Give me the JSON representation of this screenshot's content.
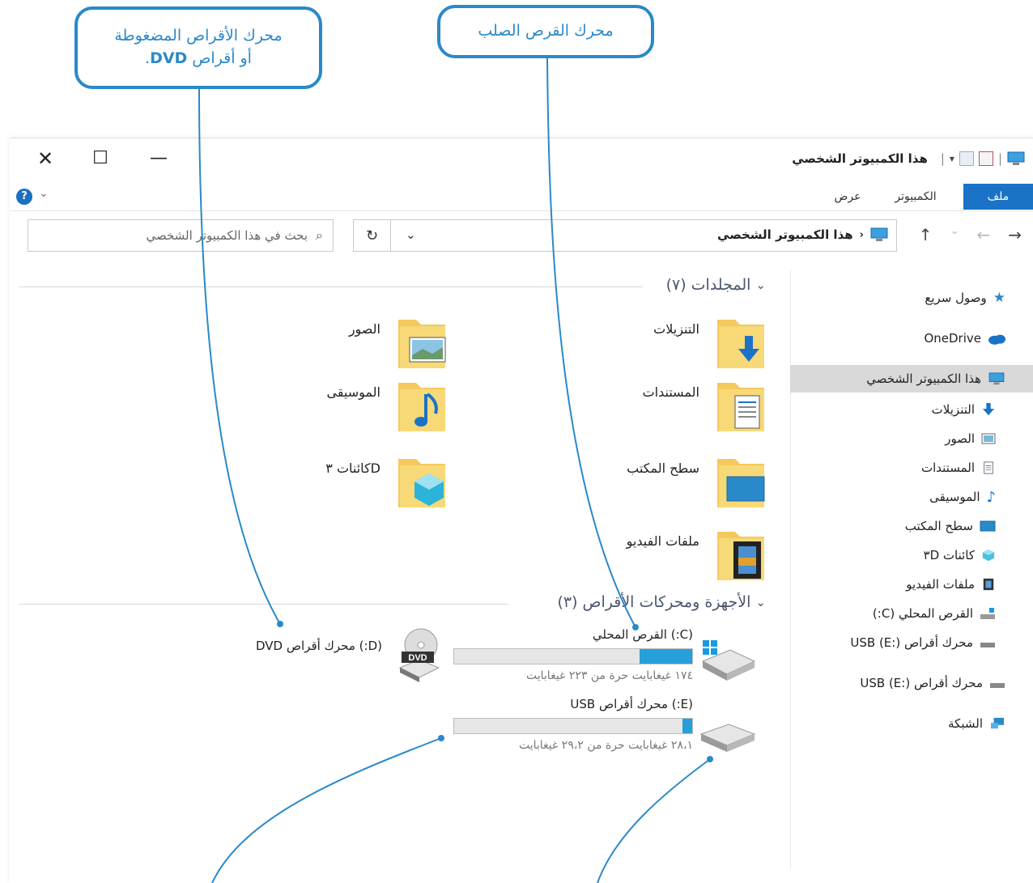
{
  "callouts": {
    "hdd": "محرك القرص الصلب",
    "dvd_line1": "محرك الأقراص المضغوطة",
    "dvd_line2_prefix": "أو أقراص",
    "dvd_line2_bold": "DVD",
    "dvd_line2_suffix": "."
  },
  "window": {
    "title": "هذا الكمبيوتر الشخصي",
    "controls": {
      "close": "✕",
      "maximize": "☐",
      "minimize": "—"
    }
  },
  "ribbon": {
    "tabs": [
      {
        "label": "ملف",
        "active": true
      },
      {
        "label": "الكمبيوتر",
        "active": false
      },
      {
        "label": "عرض",
        "active": false
      }
    ],
    "help": "?"
  },
  "address": {
    "path": "هذا الكمبيوتر الشخصي",
    "search_placeholder": "بحث في هذا الكمبيوتر الشخصي"
  },
  "sidebar": {
    "items": [
      {
        "label": "وصول سريع",
        "icon": "star-icon"
      },
      {
        "label": "OneDrive",
        "icon": "cloud-icon"
      },
      {
        "label": "هذا الكمبيوتر الشخصي",
        "icon": "computer-icon",
        "selected": true
      },
      {
        "label": "التنزيلات",
        "icon": "download-icon"
      },
      {
        "label": "الصور",
        "icon": "pictures-icon"
      },
      {
        "label": "المستندات",
        "icon": "documents-icon"
      },
      {
        "label": "الموسيقى",
        "icon": "music-icon"
      },
      {
        "label": "سطح المكتب",
        "icon": "desktop-icon"
      },
      {
        "label": "كائنات ٣D",
        "icon": "3d-objects-icon"
      },
      {
        "label": "ملفات الفيديو",
        "icon": "video-icon"
      },
      {
        "label": "القرص المحلي (C:)",
        "icon": "local-disk-icon"
      },
      {
        "label": "محرك أقراص USB (E:)",
        "icon": "usb-drive-icon"
      },
      {
        "label": "محرك أقراص USB (E:)",
        "icon": "usb-drive-icon"
      },
      {
        "label": "الشبكة",
        "icon": "network-icon"
      }
    ]
  },
  "folders_section": {
    "title": "المجلدات (٧)",
    "items": [
      {
        "label": "التنزيلات",
        "icon": "downloads-folder-icon"
      },
      {
        "label": "الصور",
        "icon": "pictures-folder-icon"
      },
      {
        "label": "المستندات",
        "icon": "documents-folder-icon"
      },
      {
        "label": "الموسيقى",
        "icon": "music-folder-icon"
      },
      {
        "label": "سطح المكتب",
        "icon": "desktop-folder-icon"
      },
      {
        "label": "Dكائنات ٣",
        "icon": "3d-objects-folder-icon"
      },
      {
        "label": "ملفات الفيديو",
        "icon": "videos-folder-icon"
      }
    ]
  },
  "devices_section": {
    "title": "الأجهزة ومحركات الأقراص (٣)",
    "drives": [
      {
        "name": "(C:) القرص المحلي",
        "free_text": "١٧٤ غيغابايت حرة من ٢٢٣ غيغابايت",
        "used_fraction": 0.22
      },
      {
        "name": "(E:) محرك أقراص USB",
        "free_text": "٢٨،١ غيغابايت حرة من ٢٩،٢ غيغابايت",
        "used_fraction": 0.04
      },
      {
        "name": "(D:) محرك أقراص DVD"
      }
    ]
  },
  "colors": {
    "accent": "#2a89c8",
    "ribbon_active": "#1a73c7",
    "drive_fill": "#26a0da",
    "folder": "#f4c95d"
  }
}
